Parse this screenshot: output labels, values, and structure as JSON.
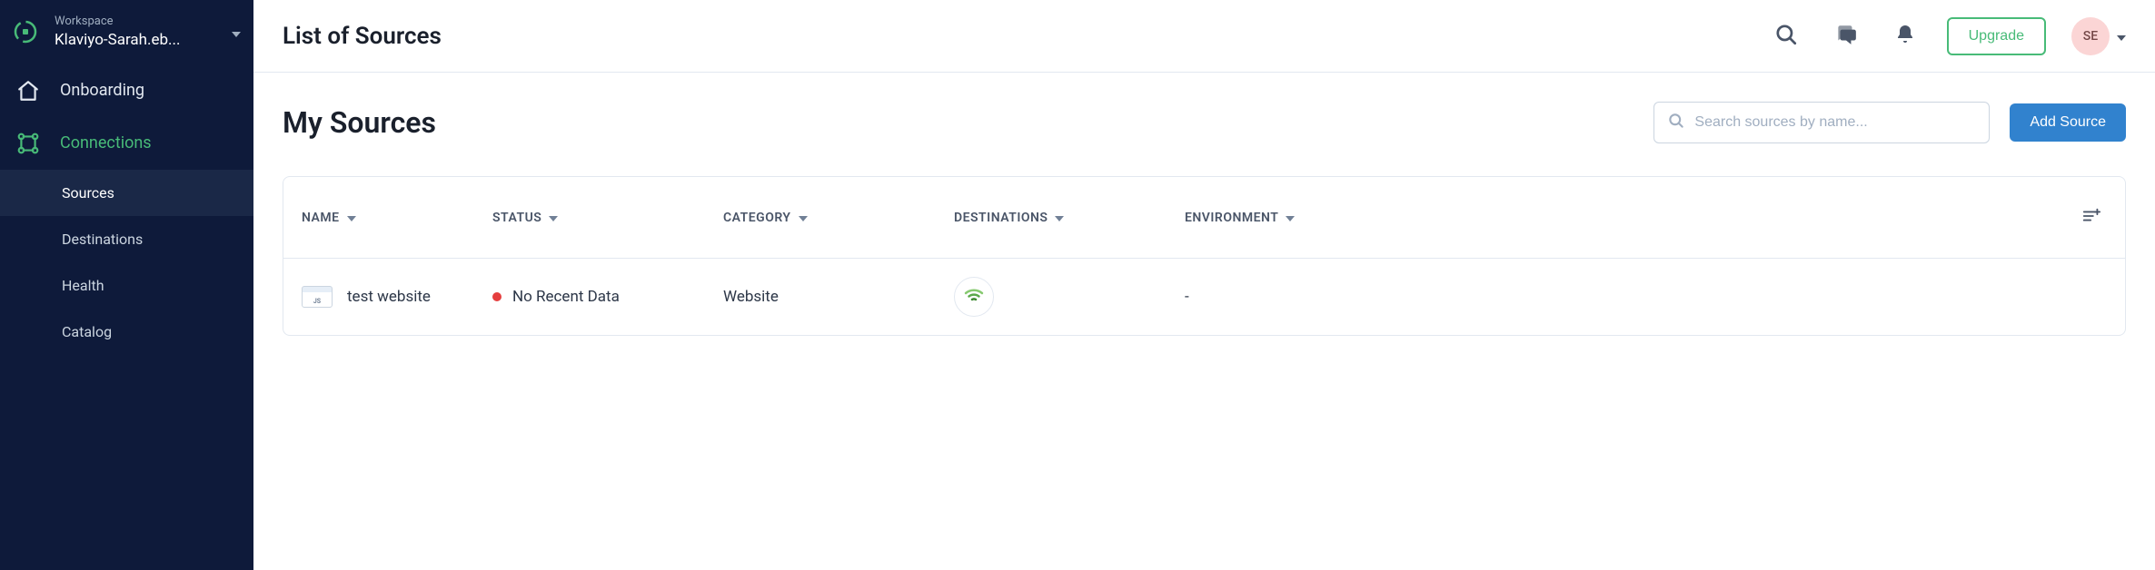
{
  "workspace": {
    "label": "Workspace",
    "name": "Klaviyo-Sarah.eb..."
  },
  "nav": {
    "onboarding": "Onboarding",
    "connections": "Connections",
    "sub": {
      "sources": "Sources",
      "destinations": "Destinations",
      "health": "Health",
      "catalog": "Catalog"
    }
  },
  "topbar": {
    "title": "List of Sources",
    "upgrade": "Upgrade",
    "avatar": "SE"
  },
  "section": {
    "title": "My Sources",
    "search_placeholder": "Search sources by name...",
    "add_button": "Add Source"
  },
  "table": {
    "headers": {
      "name": "NAME",
      "status": "STATUS",
      "category": "CATEGORY",
      "destinations": "DESTINATIONS",
      "environment": "ENVIRONMENT"
    },
    "rows": [
      {
        "icon_label": "JS",
        "name": "test website",
        "status": "No Recent Data",
        "category": "Website",
        "environment": "-"
      }
    ]
  }
}
